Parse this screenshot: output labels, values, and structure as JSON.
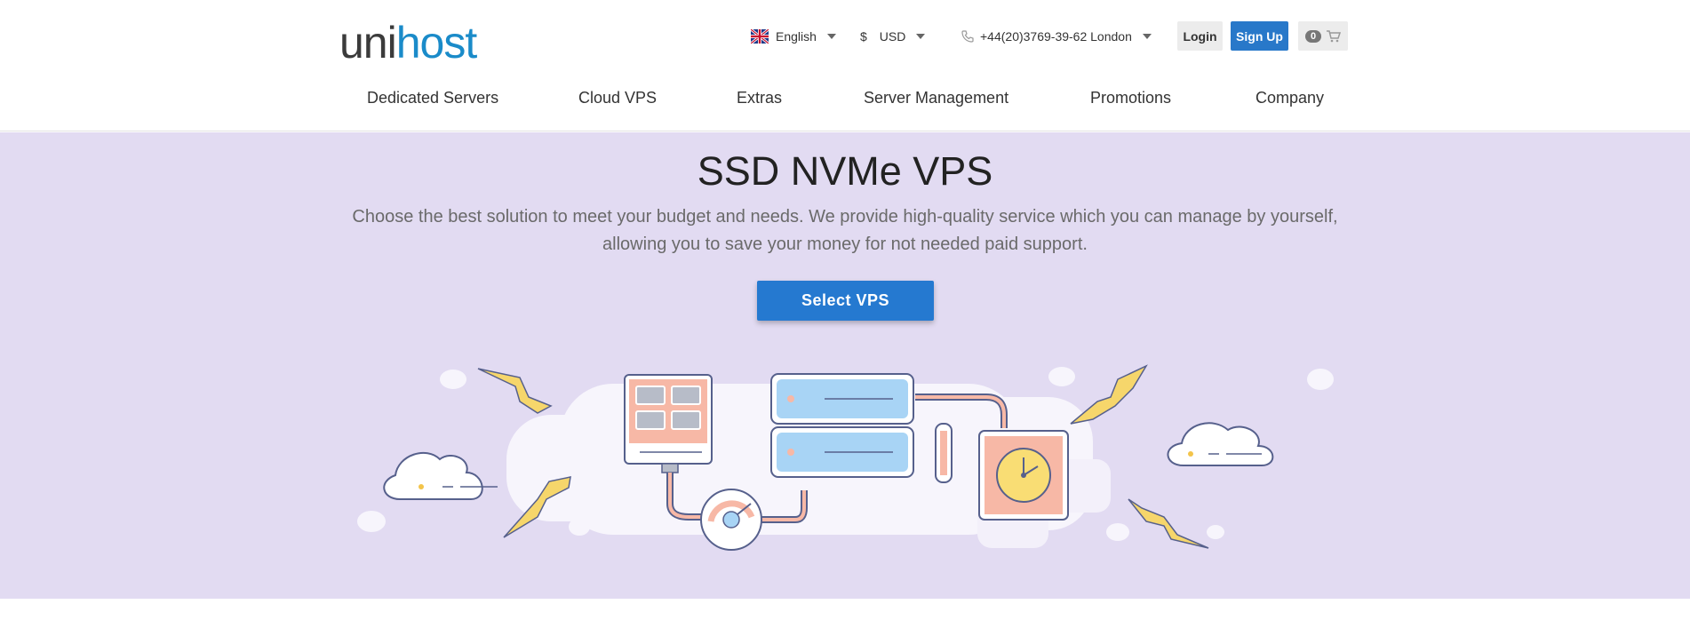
{
  "brand": {
    "logo_part1": "uni",
    "logo_part2": "host"
  },
  "topbar": {
    "language": "English",
    "currency_symbol": "$",
    "currency": "USD",
    "phone": "+44(20)3769-39-62 London",
    "login_label": "Login",
    "signup_label": "Sign Up",
    "cart_count": "0"
  },
  "nav": {
    "items": [
      {
        "label": "Dedicated Servers"
      },
      {
        "label": "Cloud VPS"
      },
      {
        "label": "Extras"
      },
      {
        "label": "Server Management"
      },
      {
        "label": "Promotions"
      },
      {
        "label": "Company"
      }
    ]
  },
  "hero": {
    "title": "SSD NVMe VPS",
    "subtitle_line1": "Choose the best solution to meet your budget and needs. We provide high-quality service which you can manage by yourself,",
    "subtitle_line2": "allowing you to save your money for not needed paid support.",
    "button_label": "Select VPS"
  },
  "colors": {
    "brand_dark": "#3b3b3b",
    "brand_accent": "#1a8bc9",
    "primary_button": "#2579d0",
    "hero_background": "#e2dbf2"
  }
}
